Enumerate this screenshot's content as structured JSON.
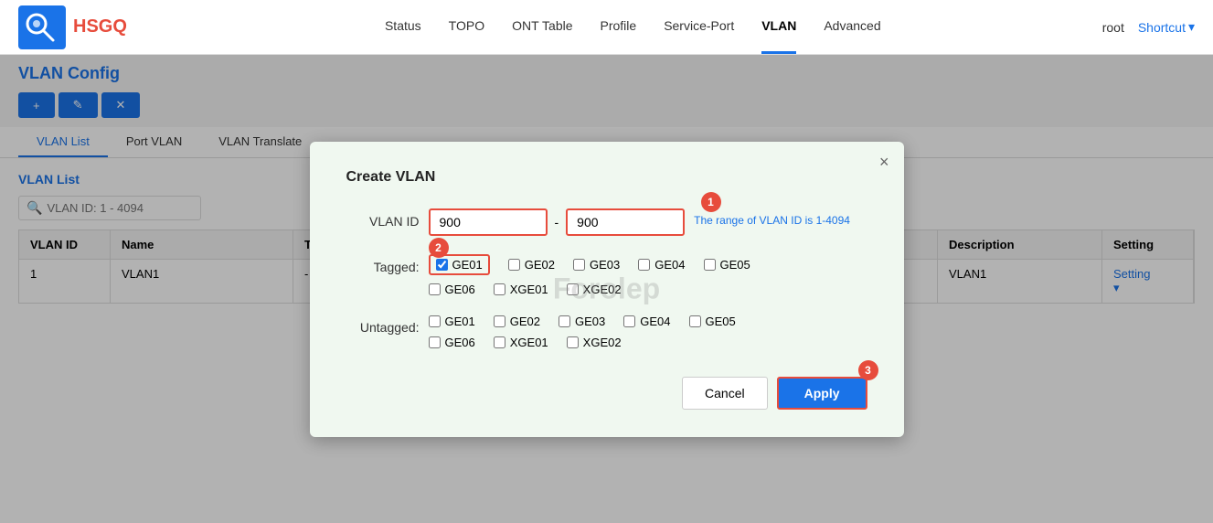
{
  "header": {
    "logo_text": "HSGQ",
    "nav": [
      {
        "label": "Status",
        "active": false
      },
      {
        "label": "TOPO",
        "active": false
      },
      {
        "label": "ONT Table",
        "active": false
      },
      {
        "label": "Profile",
        "active": false
      },
      {
        "label": "Service-Port",
        "active": false
      },
      {
        "label": "VLAN",
        "active": true
      },
      {
        "label": "Advanced",
        "active": false
      }
    ],
    "user": "root",
    "shortcut": "Shortcut"
  },
  "page": {
    "title": "VLAN Config",
    "subtabs": [
      {
        "label": "VLAN List",
        "active": true
      },
      {
        "label": "Port VLAN",
        "active": false
      },
      {
        "label": "VLAN Translate",
        "active": false
      }
    ],
    "section_title": "VLAN List",
    "search_placeholder": "VLAN ID: 1 - 4094",
    "table_headers": [
      "VLAN ID",
      "Name",
      "T",
      "",
      "Description",
      "Setting"
    ],
    "table_rows": [
      {
        "vlan_id": "1",
        "name": "VLAN1",
        "t": "-",
        "extra": "",
        "description": "VLAN1",
        "setting": "Setting"
      }
    ]
  },
  "modal": {
    "title": "Create VLAN",
    "close_label": "×",
    "vlan_id_label": "VLAN ID",
    "vlan_id_from": "900",
    "vlan_id_to": "900",
    "vlan_id_separator": "-",
    "vlan_range_hint": "The range of VLAN ID is 1-4094",
    "tagged_label": "Tagged:",
    "tagged_ports": [
      {
        "id": "GE01",
        "checked": true,
        "highlighted": true
      },
      {
        "id": "GE02",
        "checked": false,
        "highlighted": false
      },
      {
        "id": "GE03",
        "checked": false,
        "highlighted": false
      },
      {
        "id": "GE04",
        "checked": false,
        "highlighted": false
      },
      {
        "id": "GE05",
        "checked": false,
        "highlighted": false
      },
      {
        "id": "GE06",
        "checked": false,
        "highlighted": false
      },
      {
        "id": "XGE01",
        "checked": false,
        "highlighted": false
      },
      {
        "id": "XGE02",
        "checked": false,
        "highlighted": false
      }
    ],
    "untagged_label": "Untagged:",
    "untagged_ports": [
      {
        "id": "GE01",
        "checked": false
      },
      {
        "id": "GE02",
        "checked": false
      },
      {
        "id": "GE03",
        "checked": false
      },
      {
        "id": "GE04",
        "checked": false
      },
      {
        "id": "GE05",
        "checked": false
      },
      {
        "id": "GE06",
        "checked": false
      },
      {
        "id": "XGE01",
        "checked": false
      },
      {
        "id": "XGE02",
        "checked": false
      }
    ],
    "cancel_label": "Cancel",
    "apply_label": "Apply",
    "step_badges": [
      "1",
      "2",
      "3"
    ],
    "watermark": "Forolep"
  }
}
